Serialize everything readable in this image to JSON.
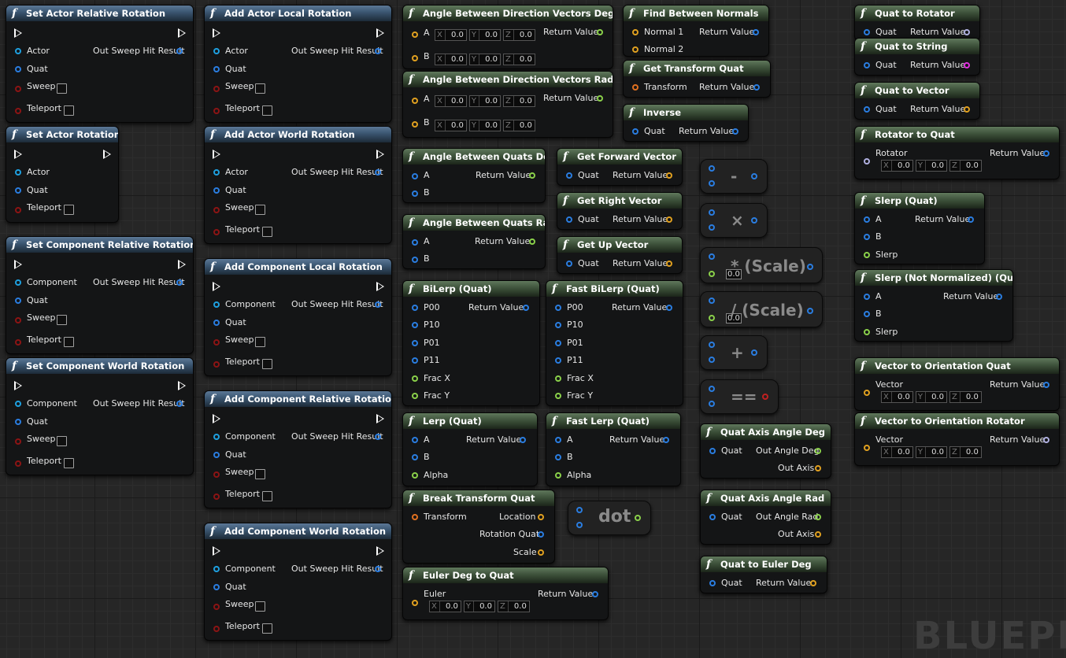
{
  "watermark": "BLUEPR",
  "nodes": {
    "set_actor_relative_rotation": {
      "title": "Set Actor Relative Rotation",
      "pins": {
        "actor": "Actor",
        "quat": "Quat",
        "sweep": "Sweep",
        "teleport": "Teleport",
        "out": "Out Sweep Hit Result"
      }
    },
    "set_actor_rotation": {
      "title": "Set Actor Rotation",
      "pins": {
        "actor": "Actor",
        "quat": "Quat",
        "teleport": "Teleport"
      }
    },
    "set_component_relative_rotation": {
      "title": "Set Component Relative Rotation",
      "pins": {
        "component": "Component",
        "quat": "Quat",
        "sweep": "Sweep",
        "teleport": "Teleport",
        "out": "Out Sweep Hit Result"
      }
    },
    "set_component_world_rotation": {
      "title": "Set Component World Rotation",
      "pins": {
        "component": "Component",
        "quat": "Quat",
        "sweep": "Sweep",
        "teleport": "Teleport",
        "out": "Out Sweep Hit Result"
      }
    },
    "add_actor_local_rotation": {
      "title": "Add Actor Local Rotation",
      "pins": {
        "actor": "Actor",
        "quat": "Quat",
        "sweep": "Sweep",
        "teleport": "Teleport",
        "out": "Out Sweep Hit Result"
      }
    },
    "add_actor_world_rotation": {
      "title": "Add Actor World Rotation",
      "pins": {
        "actor": "Actor",
        "quat": "Quat",
        "sweep": "Sweep",
        "teleport": "Teleport",
        "out": "Out Sweep Hit Result"
      }
    },
    "add_component_local_rotation": {
      "title": "Add Component Local Rotation",
      "pins": {
        "component": "Component",
        "quat": "Quat",
        "sweep": "Sweep",
        "teleport": "Teleport",
        "out": "Out Sweep Hit Result"
      }
    },
    "add_component_relative_rotation": {
      "title": "Add Component Relative Rotation",
      "pins": {
        "component": "Component",
        "quat": "Quat",
        "sweep": "Sweep",
        "teleport": "Teleport",
        "out": "Out Sweep Hit Result"
      }
    },
    "add_component_world_rotation": {
      "title": "Add Component World Rotation",
      "pins": {
        "component": "Component",
        "quat": "Quat",
        "sweep": "Sweep",
        "teleport": "Teleport",
        "out": "Out Sweep Hit Result"
      }
    },
    "angle_dir_deg": {
      "title": "Angle Between Direction Vectors Deg",
      "pins": {
        "a": "A",
        "b": "B",
        "ret": "Return Value"
      }
    },
    "angle_dir_rad": {
      "title": "Angle Between Direction Vectors Rad",
      "pins": {
        "a": "A",
        "b": "B",
        "ret": "Return Value"
      }
    },
    "find_between_normals": {
      "title": "Find Between Normals",
      "pins": {
        "n1": "Normal 1",
        "n2": "Normal 2",
        "ret": "Return Value"
      }
    },
    "get_transform_quat": {
      "title": "Get Transform Quat",
      "pins": {
        "transform": "Transform",
        "ret": "Return Value"
      }
    },
    "inverse": {
      "title": "Inverse",
      "pins": {
        "quat": "Quat",
        "ret": "Return Value"
      }
    },
    "angle_quats_deg": {
      "title": "Angle Between Quats Deg",
      "pins": {
        "a": "A",
        "b": "B",
        "ret": "Return Value"
      }
    },
    "angle_quats_rad": {
      "title": "Angle Between Quats Rad",
      "pins": {
        "a": "A",
        "b": "B",
        "ret": "Return Value"
      }
    },
    "get_forward_vector": {
      "title": "Get Forward Vector",
      "pins": {
        "quat": "Quat",
        "ret": "Return Value"
      }
    },
    "get_right_vector": {
      "title": "Get Right Vector",
      "pins": {
        "quat": "Quat",
        "ret": "Return Value"
      }
    },
    "get_up_vector": {
      "title": "Get Up Vector",
      "pins": {
        "quat": "Quat",
        "ret": "Return Value"
      }
    },
    "bilerp": {
      "title": "BiLerp (Quat)",
      "pins": {
        "p00": "P00",
        "p10": "P10",
        "p01": "P01",
        "p11": "P11",
        "fx": "Frac X",
        "fy": "Frac Y",
        "ret": "Return Value"
      }
    },
    "fast_bilerp": {
      "title": "Fast BiLerp (Quat)",
      "pins": {
        "p00": "P00",
        "p10": "P10",
        "p01": "P01",
        "p11": "P11",
        "fx": "Frac X",
        "fy": "Frac Y",
        "ret": "Return Value"
      }
    },
    "lerp": {
      "title": "Lerp (Quat)",
      "pins": {
        "a": "A",
        "b": "B",
        "alpha": "Alpha",
        "ret": "Return Value"
      }
    },
    "fast_lerp": {
      "title": "Fast Lerp (Quat)",
      "pins": {
        "a": "A",
        "b": "B",
        "alpha": "Alpha",
        "ret": "Return Value"
      }
    },
    "break_transform_quat": {
      "title": "Break Transform Quat",
      "pins": {
        "transform": "Transform",
        "location": "Location",
        "rotation": "Rotation Quat",
        "scale": "Scale"
      }
    },
    "euler_deg_to_quat": {
      "title": "Euler Deg to Quat",
      "pins": {
        "euler": "Euler",
        "ret": "Return Value"
      }
    },
    "quat_axis_angle_deg": {
      "title": "Quat Axis Angle Deg",
      "pins": {
        "quat": "Quat",
        "angle": "Out Angle Deg",
        "axis": "Out Axis"
      }
    },
    "quat_axis_angle_rad": {
      "title": "Quat Axis Angle Rad",
      "pins": {
        "quat": "Quat",
        "angle": "Out Angle Rad",
        "axis": "Out Axis"
      }
    },
    "quat_to_euler_deg": {
      "title": "Quat to Euler Deg",
      "pins": {
        "quat": "Quat",
        "ret": "Return Value"
      }
    },
    "quat_to_rotator": {
      "title": "Quat to Rotator",
      "pins": {
        "quat": "Quat",
        "ret": "Return Value"
      }
    },
    "quat_to_string": {
      "title": "Quat to String",
      "pins": {
        "quat": "Quat",
        "ret": "Return Value"
      }
    },
    "quat_to_vector": {
      "title": "Quat to Vector",
      "pins": {
        "quat": "Quat",
        "ret": "Return Value"
      }
    },
    "rotator_to_quat": {
      "title": "Rotator to Quat",
      "pins": {
        "rotator": "Rotator",
        "ret": "Return Value"
      }
    },
    "slerp": {
      "title": "Slerp (Quat)",
      "pins": {
        "a": "A",
        "b": "B",
        "slerp": "Slerp",
        "ret": "Return Value"
      }
    },
    "slerp_nn": {
      "title": "Slerp (Not Normalized) (Quat)",
      "pins": {
        "a": "A",
        "b": "B",
        "slerp": "Slerp",
        "ret": "Return Value"
      }
    },
    "vec_to_orient_quat": {
      "title": "Vector to Orientation Quat",
      "pins": {
        "vector": "Vector",
        "ret": "Return Value"
      }
    },
    "vec_to_orient_rot": {
      "title": "Vector to Orientation Rotator",
      "pins": {
        "vector": "Vector",
        "ret": "Return Value"
      }
    }
  },
  "vector_default": {
    "x_label": "X",
    "y_label": "Y",
    "z_label": "Z",
    "x": "0.0",
    "y": "0.0",
    "z": "0.0"
  },
  "operators": {
    "minus": "-",
    "multiply": "×",
    "mul_scale": "* (Scale)",
    "div_scale": "/ (Scale)",
    "plus": "+",
    "equals": "==",
    "dot": "dot",
    "scale_default": "0.0"
  },
  "colors": {
    "quat_pin": "#2a7de0",
    "vector_pin": "#e0a020",
    "transform_pin": "#e07020",
    "bool_pin": "#8c1414",
    "float_pin": "#8ad04a",
    "string_pin": "#e030e0",
    "rotator_pin": "#b0b0e0",
    "object_pin": "#1ea0e0",
    "pure_header": "#41563e",
    "impure_header": "#3c5874"
  }
}
